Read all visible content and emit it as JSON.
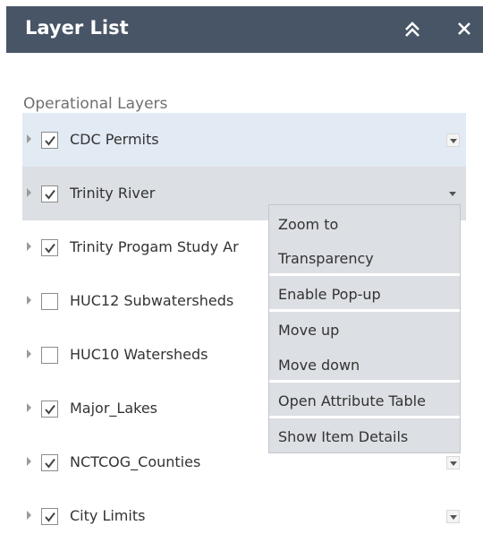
{
  "panel": {
    "title": "Layer List",
    "collapse_icon": "double-chevron-up-icon",
    "close_icon": "close-icon"
  },
  "section_label": "Operational Layers",
  "layers": [
    {
      "label": "CDC Permits",
      "checked": true
    },
    {
      "label": "Trinity River",
      "checked": true
    },
    {
      "label": "Trinity Progam Study Ar",
      "checked": true
    },
    {
      "label": "HUC12 Subwatersheds",
      "checked": false
    },
    {
      "label": "HUC10 Watersheds",
      "checked": false
    },
    {
      "label": "Major_Lakes",
      "checked": true
    },
    {
      "label": "NCTCOG_Counties",
      "checked": true
    },
    {
      "label": "City Limits",
      "checked": true
    }
  ],
  "context_menu": {
    "items": [
      "Zoom to",
      "Transparency",
      "Enable Pop-up",
      "Move up",
      "Move down",
      "Open Attribute Table",
      "Show Item Details"
    ]
  },
  "colors": {
    "header_bg": "#485566",
    "row_highlight": "#e2ebf4",
    "row_active": "#dcdfe3",
    "menu_bg": "#dcdfe3"
  }
}
